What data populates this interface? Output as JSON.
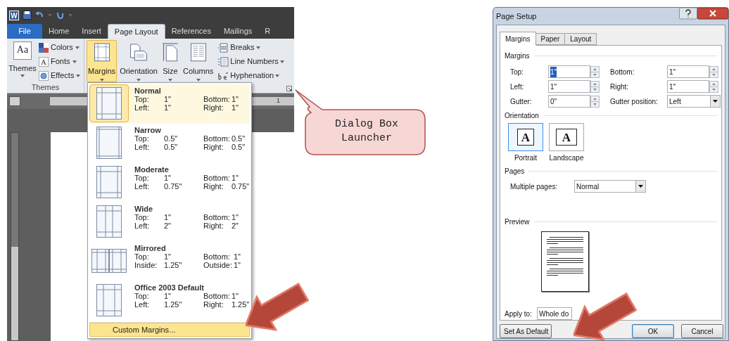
{
  "word": {
    "app_icon_letter": "W",
    "tabs": [
      {
        "label": "File",
        "kind": "file",
        "selected": false
      },
      {
        "label": "Home",
        "kind": "tab",
        "selected": false
      },
      {
        "label": "Insert",
        "kind": "tab",
        "selected": false
      },
      {
        "label": "Page Layout",
        "kind": "tab",
        "selected": true
      },
      {
        "label": "References",
        "kind": "tab",
        "selected": false
      },
      {
        "label": "Mailings",
        "kind": "tab",
        "selected": false
      },
      {
        "label": "R",
        "kind": "tab",
        "selected": false
      }
    ],
    "themes_group": {
      "label": "Themes",
      "button": "Themes",
      "icon_text": "Aa",
      "items": [
        {
          "kind": "colors",
          "label": "Colors"
        },
        {
          "kind": "fonts",
          "label": "Fonts",
          "icon_text": "A"
        },
        {
          "kind": "effects",
          "label": "Effects"
        }
      ]
    },
    "page_setup_group": {
      "buttons": [
        {
          "kind": "margins",
          "label": "Margins",
          "selected": true
        },
        {
          "kind": "orientation",
          "label": "Orientation",
          "selected": false
        },
        {
          "kind": "size",
          "label": "Size",
          "selected": false
        },
        {
          "kind": "columns",
          "label": "Columns",
          "selected": false
        }
      ],
      "items": [
        {
          "kind": "breaks",
          "label": "Breaks"
        },
        {
          "kind": "line_numbers",
          "label": "Line Numbers"
        },
        {
          "kind": "hyphenation",
          "label": "Hyphenation"
        }
      ]
    },
    "ruler_mark": "1",
    "margins_menu": {
      "presets": [
        {
          "name": "Normal",
          "kind": "normal",
          "selected": true,
          "values": [
            [
              "Top:",
              "1\"",
              "Bottom:",
              "1\""
            ],
            [
              "Left:",
              "1\"",
              "Right:",
              "1\""
            ]
          ]
        },
        {
          "name": "Narrow",
          "kind": "narrow",
          "selected": false,
          "values": [
            [
              "Top:",
              "0.5\"",
              "Bottom:",
              "0.5\""
            ],
            [
              "Left:",
              "0.5\"",
              "Right:",
              "0.5\""
            ]
          ]
        },
        {
          "name": "Moderate",
          "kind": "moderate",
          "selected": false,
          "values": [
            [
              "Top:",
              "1\"",
              "Bottom:",
              "1\""
            ],
            [
              "Left:",
              "0.75\"",
              "Right:",
              "0.75\""
            ]
          ]
        },
        {
          "name": "Wide",
          "kind": "wide",
          "selected": false,
          "values": [
            [
              "Top:",
              "1\"",
              "Bottom:",
              "1\""
            ],
            [
              "Left:",
              "2\"",
              "Right:",
              "2\""
            ]
          ]
        },
        {
          "name": "Mirrored",
          "kind": "mirrored",
          "selected": false,
          "values": [
            [
              "Top:",
              "1\"",
              "Bottom:",
              "1\""
            ],
            [
              "Inside:",
              "1.25\"",
              "Outside:",
              "1\""
            ]
          ]
        },
        {
          "name": "Office 2003 Default",
          "kind": "office2003",
          "selected": false,
          "values": [
            [
              "Top:",
              "1\"",
              "Bottom:",
              "1\""
            ],
            [
              "Left:",
              "1.25\"",
              "Right:",
              "1.25\""
            ]
          ]
        }
      ],
      "custom": {
        "label": "Custom Margins...",
        "selected": true
      }
    }
  },
  "callout": {
    "text": "Dialog Box Launcher"
  },
  "dialog": {
    "title": "Page Setup",
    "tabs": [
      {
        "label": "Margins",
        "selected": true
      },
      {
        "label": "Paper",
        "selected": false
      },
      {
        "label": "Layout",
        "selected": false
      }
    ],
    "margins": {
      "heading": "Margins",
      "fields": [
        {
          "label": "Top:",
          "value": "1\"",
          "kind": "spin",
          "focused": true
        },
        {
          "label": "Bottom:",
          "value": "1\"",
          "kind": "spin",
          "focused": false
        },
        {
          "label": "Left:",
          "value": "1\"",
          "kind": "spin",
          "focused": false
        },
        {
          "label": "Right:",
          "value": "1\"",
          "kind": "spin",
          "focused": false
        },
        {
          "label": "Gutter:",
          "value": "0\"",
          "kind": "spin",
          "focused": false
        },
        {
          "label": "Gutter position:",
          "value": "Left",
          "kind": "select",
          "focused": false
        }
      ]
    },
    "orientation": {
      "heading": "Orientation",
      "options": [
        {
          "label": "Portrait",
          "kind": "portrait",
          "icon_text": "A",
          "selected": true
        },
        {
          "label": "Landscape",
          "kind": "landscape",
          "icon_text": "A",
          "selected": false
        }
      ]
    },
    "pages": {
      "heading": "Pages",
      "label": "Multiple pages:",
      "value": "Normal"
    },
    "preview": {
      "heading": "Preview"
    },
    "apply_to": {
      "label": "Apply to:",
      "value": "Whole do"
    },
    "buttons": [
      {
        "label": "Set As Default",
        "default": false
      },
      {
        "label": "OK",
        "default": true
      },
      {
        "label": "Cancel",
        "default": false
      }
    ]
  }
}
